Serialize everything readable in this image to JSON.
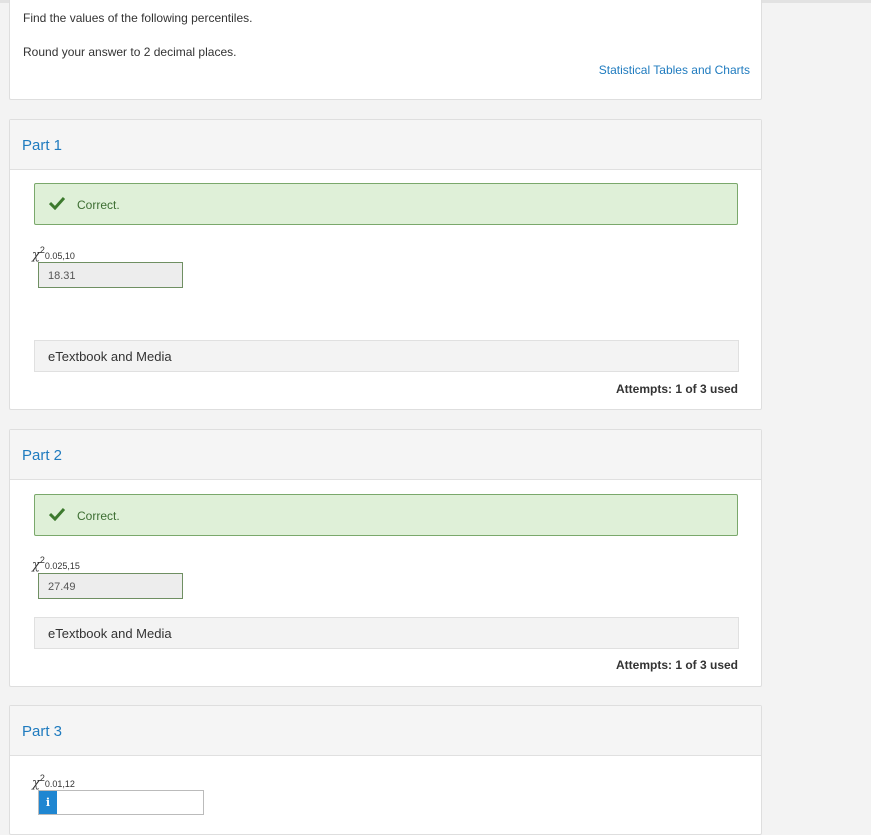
{
  "intro": {
    "line1": "Find the values of the following percentiles.",
    "line2": "Round your answer to 2 decimal places.",
    "tables_link": "Statistical Tables and Charts"
  },
  "parts": [
    {
      "title": "Part 1",
      "status": "Correct.",
      "symbol": "χ",
      "superscript": "2",
      "subscript": "0.05,10",
      "answer": "18.31",
      "etext": "eTextbook and Media",
      "attempts": "Attempts: 1 of 3 used"
    },
    {
      "title": "Part 2",
      "status": "Correct.",
      "symbol": "χ",
      "superscript": "2",
      "subscript": "0.025,15",
      "answer": "27.49",
      "etext": "eTextbook and Media",
      "attempts": "Attempts: 1 of 3 used"
    },
    {
      "title": "Part 3",
      "symbol": "χ",
      "superscript": "2",
      "subscript": "0.01,12",
      "answer": "",
      "info_badge": "i"
    }
  ],
  "colors": {
    "link": "#1f7bbf",
    "correct_bg": "#dff0d8",
    "correct_border": "#7aa86b",
    "check": "#3d7a2e",
    "info_badge": "#1f86d1"
  },
  "icons": {
    "check": "checkmark-icon",
    "info": "info-icon"
  }
}
